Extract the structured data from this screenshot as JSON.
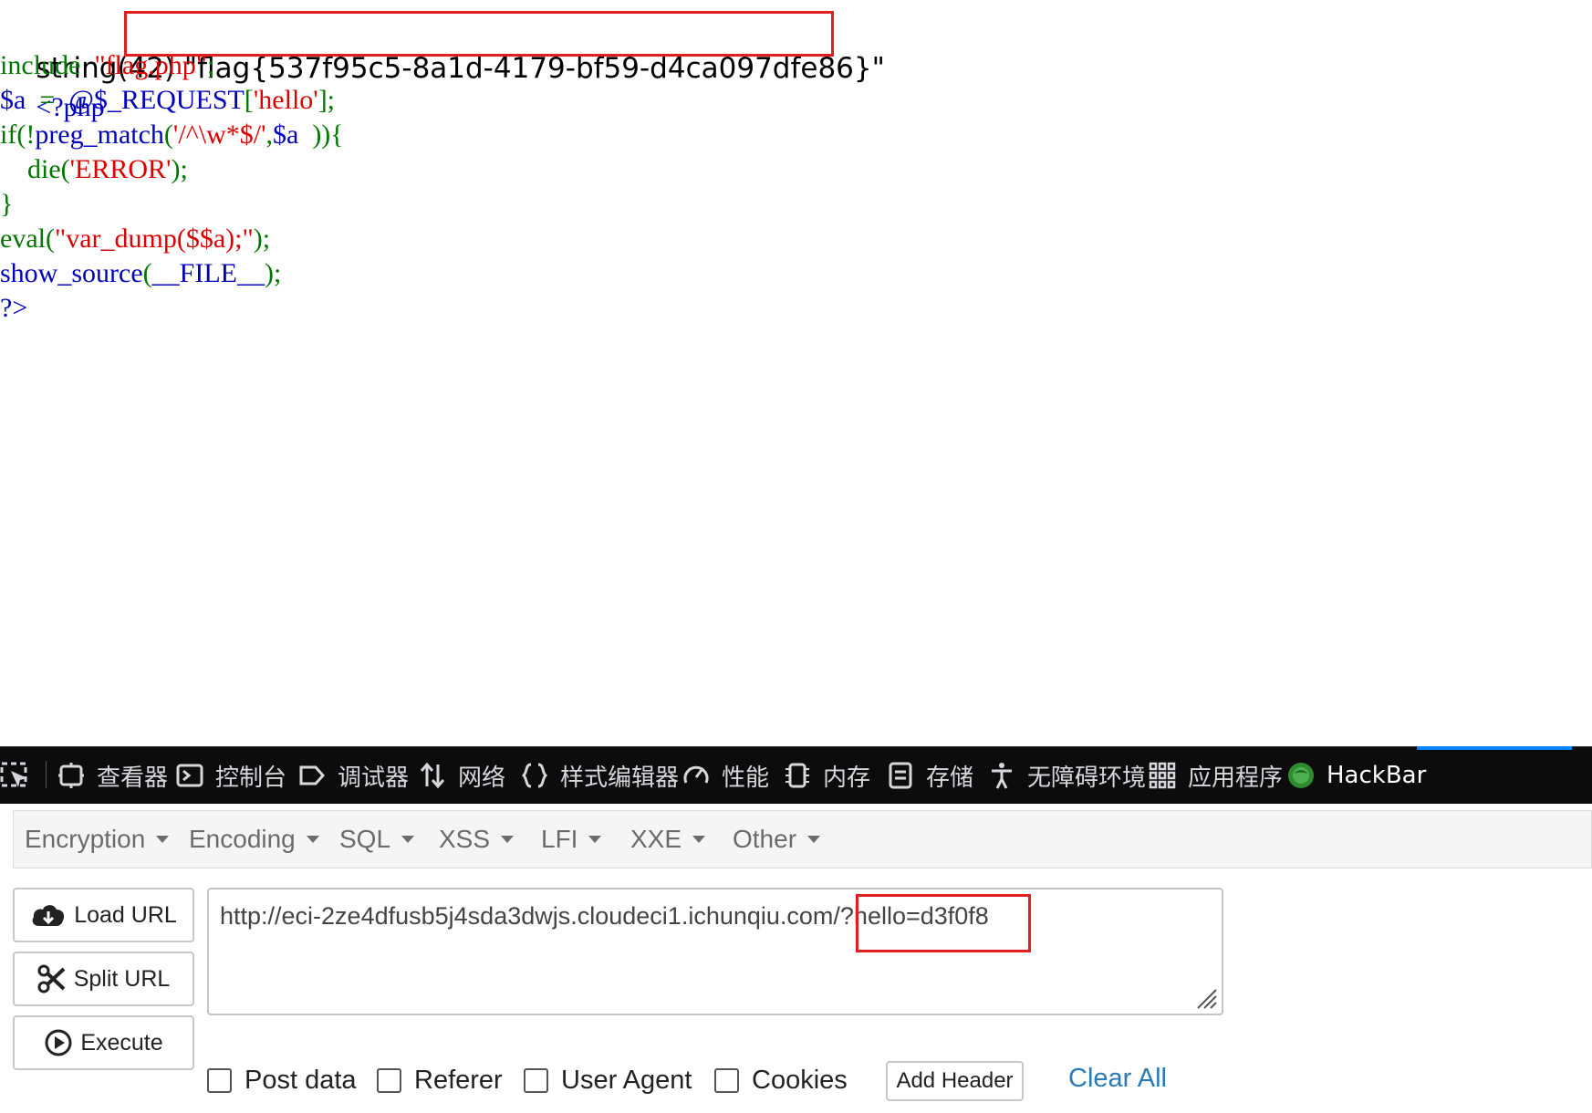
{
  "output": {
    "result_prefix": "string(42)",
    "result_value": " \"flag{537f95c5-8a1d-4179-bf59-d4ca097dfe86}\"",
    "php_open": "<?php",
    "source_lines": [
      [
        {
          "t": "include  ",
          "c": "green"
        },
        {
          "t": "\"flag.php\"",
          "c": "red"
        },
        {
          "t": ";",
          "c": "green"
        }
      ],
      [
        {
          "t": "$a  ",
          "c": "blue"
        },
        {
          "t": "=  ",
          "c": "green"
        },
        {
          "t": "@$_REQUEST",
          "c": "blue"
        },
        {
          "t": "[",
          "c": "green"
        },
        {
          "t": "'hello'",
          "c": "red"
        },
        {
          "t": "];",
          "c": "green"
        }
      ],
      [
        {
          "t": "if(!",
          "c": "green"
        },
        {
          "t": "preg_match",
          "c": "blue"
        },
        {
          "t": "(",
          "c": "green"
        },
        {
          "t": "'/^\\w*$/'",
          "c": "red"
        },
        {
          "t": ",",
          "c": "green"
        },
        {
          "t": "$a  ",
          "c": "blue"
        },
        {
          "t": ")){",
          "c": "green"
        }
      ],
      [
        {
          "t": "    die(",
          "c": "green"
        },
        {
          "t": "'ERROR'",
          "c": "red"
        },
        {
          "t": ");",
          "c": "green"
        }
      ],
      [
        {
          "t": "}",
          "c": "green"
        }
      ],
      [
        {
          "t": "eval(",
          "c": "green"
        },
        {
          "t": "\"var_dump($$a);\"",
          "c": "red"
        },
        {
          "t": ");",
          "c": "green"
        }
      ],
      [
        {
          "t": "show_source",
          "c": "blue"
        },
        {
          "t": "(",
          "c": "green"
        },
        {
          "t": "__FILE__",
          "c": "blue"
        },
        {
          "t": ");",
          "c": "green"
        }
      ],
      [
        {
          "t": "?>",
          "c": "blue"
        }
      ]
    ]
  },
  "devtools": {
    "tabs": [
      {
        "label": "查看器",
        "icon": "inspector-icon"
      },
      {
        "label": "控制台",
        "icon": "console-icon"
      },
      {
        "label": "调试器",
        "icon": "debugger-icon"
      },
      {
        "label": "网络",
        "icon": "network-icon"
      },
      {
        "label": "样式编辑器",
        "icon": "style-editor-icon"
      },
      {
        "label": "性能",
        "icon": "performance-icon"
      },
      {
        "label": "内存",
        "icon": "memory-icon"
      },
      {
        "label": "存储",
        "icon": "storage-icon"
      },
      {
        "label": "无障碍环境",
        "icon": "accessibility-icon"
      },
      {
        "label": "应用程序",
        "icon": "application-icon"
      },
      {
        "label": "HackBar",
        "icon": "hackbar-icon",
        "active": true
      }
    ]
  },
  "hackbar": {
    "menu": [
      "Encryption",
      "Encoding",
      "SQL",
      "XSS",
      "LFI",
      "XXE",
      "Other"
    ],
    "buttons": {
      "load": "Load URL",
      "split": "Split URL",
      "execute": "Execute"
    },
    "url_base": "http://eci-2ze4dfusb5j4sda3dwjs.cloudeci1.ichunqiu.com/",
    "url_query": "?hello=d3f0f8",
    "options": {
      "post": "Post data",
      "referer": "Referer",
      "user_agent": "User Agent",
      "cookies": "Cookies"
    },
    "add_header": "Add Header",
    "clear_all": "Clear All"
  },
  "colors": {
    "highlight_box": "#e02020",
    "link": "#2a7ab8",
    "devtools_bg": "#0c0c0d",
    "active_tab": "#0a84ff"
  }
}
